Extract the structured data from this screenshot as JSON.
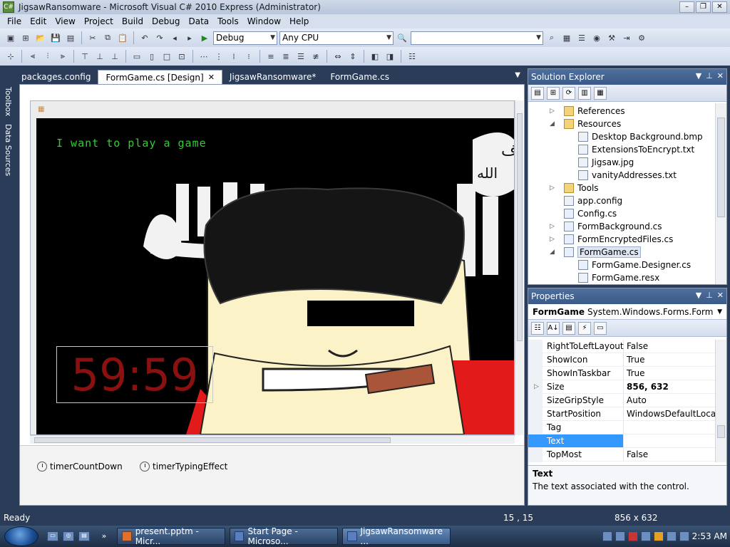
{
  "window": {
    "title": "JigsawRansomware - Microsoft Visual C# 2010 Express (Administrator)",
    "app_icon": "vs-icon"
  },
  "menu": [
    "File",
    "Edit",
    "View",
    "Project",
    "Build",
    "Debug",
    "Data",
    "Tools",
    "Window",
    "Help"
  ],
  "toolbar": {
    "config_value": "Debug",
    "platform_value": "Any CPU",
    "search_value": ""
  },
  "left_strip": {
    "toolbox": "Toolbox",
    "data_sources": "Data Sources"
  },
  "document_tabs": [
    {
      "label": "packages.config",
      "active": false
    },
    {
      "label": "FormGame.cs [Design]",
      "active": true,
      "close": "✕"
    },
    {
      "label": "JigsawRansomware*",
      "active": false
    },
    {
      "label": "FormGame.cs",
      "active": false
    }
  ],
  "designer": {
    "game_text": "I want to play a game",
    "countdown": "59:59",
    "components": [
      "timerCountDown",
      "timerTypingEffect"
    ],
    "banner_script": "ف",
    "banner_script2": "الله"
  },
  "solution_explorer": {
    "title": "Solution Explorer",
    "items": [
      {
        "label": "References",
        "indent": 1,
        "expand": "▷",
        "icon": "folder"
      },
      {
        "label": "Resources",
        "indent": 1,
        "expand": "◢",
        "icon": "folder"
      },
      {
        "label": "Desktop Background.bmp",
        "indent": 2,
        "icon": "image"
      },
      {
        "label": "ExtensionsToEncrypt.txt",
        "indent": 2,
        "icon": "file"
      },
      {
        "label": "Jigsaw.jpg",
        "indent": 2,
        "icon": "image"
      },
      {
        "label": "vanityAddresses.txt",
        "indent": 2,
        "icon": "file"
      },
      {
        "label": "Tools",
        "indent": 1,
        "expand": "▷",
        "icon": "folder"
      },
      {
        "label": "app.config",
        "indent": 1,
        "icon": "file"
      },
      {
        "label": "Config.cs",
        "indent": 1,
        "icon": "cs"
      },
      {
        "label": "FormBackground.cs",
        "indent": 1,
        "expand": "▷",
        "icon": "cs"
      },
      {
        "label": "FormEncryptedFiles.cs",
        "indent": 1,
        "expand": "▷",
        "icon": "cs"
      },
      {
        "label": "FormGame.cs",
        "indent": 1,
        "expand": "◢",
        "icon": "cs",
        "selected": true
      },
      {
        "label": "FormGame.Designer.cs",
        "indent": 2,
        "icon": "cs"
      },
      {
        "label": "FormGame.resx",
        "indent": 2,
        "icon": "file"
      }
    ]
  },
  "properties": {
    "title": "Properties",
    "object_name": "FormGame",
    "object_type": "System.Windows.Forms.Form",
    "rows": [
      {
        "name": "RightToLeftLayout",
        "value": "False"
      },
      {
        "name": "ShowIcon",
        "value": "True"
      },
      {
        "name": "ShowInTaskbar",
        "value": "True"
      },
      {
        "name": "Size",
        "value": "856, 632",
        "bold": true,
        "expand": "▷"
      },
      {
        "name": "SizeGripStyle",
        "value": "Auto"
      },
      {
        "name": "StartPosition",
        "value": "WindowsDefaultLocation"
      },
      {
        "name": "Tag",
        "value": ""
      },
      {
        "name": "Text",
        "value": "",
        "selected": true
      },
      {
        "name": "TopMost",
        "value": "False"
      }
    ],
    "desc_title": "Text",
    "desc_text": "The text associated with the control."
  },
  "status": {
    "ready": "Ready",
    "position": "15 , 15",
    "size": "856 x 632"
  },
  "taskbar": {
    "buttons": [
      {
        "label": "present.pptm - Micr..."
      },
      {
        "label": "Start Page - Microso..."
      },
      {
        "label": "JigsawRansomware ...",
        "active": true
      }
    ],
    "clock": "2:53 AM"
  }
}
